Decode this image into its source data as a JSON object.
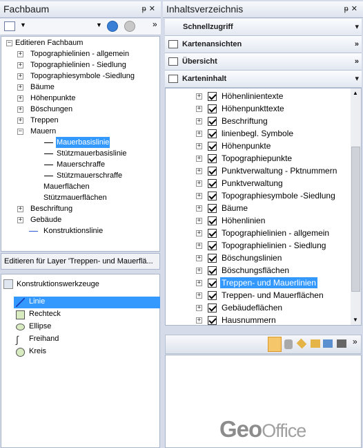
{
  "left_panel": {
    "title": "Fachbaum",
    "tree_root": "Editieren Fachbaum",
    "tree": [
      {
        "label": "Topographielinien - allgemein",
        "level": 1,
        "expander": "+"
      },
      {
        "label": "Topographielinien - Siedlung",
        "level": 1,
        "expander": "+"
      },
      {
        "label": "Topographiesymbole -Siedlung",
        "level": 1,
        "expander": "+"
      },
      {
        "label": "Bäume",
        "level": 1,
        "expander": "+"
      },
      {
        "label": "Höhenpunkte",
        "level": 1,
        "expander": "+"
      },
      {
        "label": "Böschungen",
        "level": 1,
        "expander": "+"
      },
      {
        "label": "Treppen",
        "level": 1,
        "expander": "+"
      },
      {
        "label": "Mauern",
        "level": 1,
        "expander": "-"
      },
      {
        "label": "Mauerbasislinie",
        "level": 2,
        "line": true,
        "selected": true
      },
      {
        "label": "Stützmauerbasislinie",
        "level": 2,
        "line": true
      },
      {
        "label": "Mauerschraffe",
        "level": 2,
        "line": true
      },
      {
        "label": "Stützmauerschraffe",
        "level": 2,
        "line": true
      },
      {
        "label": "Mauerflächen",
        "level": 2
      },
      {
        "label": "Stützmauerflächen",
        "level": 2
      },
      {
        "label": "Beschriftung",
        "level": 1,
        "expander": "+"
      },
      {
        "label": "Gebäude",
        "level": 1,
        "expander": "+"
      },
      {
        "label": "Konstruktionslinie",
        "level": 2,
        "blueline": true
      }
    ],
    "status": "Editieren für Layer 'Treppen- und Mauerflä...",
    "tools_header": "Konstruktionswerkzeuge",
    "tools": [
      {
        "label": "Linie",
        "icon": "line-icon",
        "selected": true
      },
      {
        "label": "Rechteck",
        "icon": "rectangle-icon"
      },
      {
        "label": "Ellipse",
        "icon": "ellipse-icon"
      },
      {
        "label": "Freihand",
        "icon": "freehand-icon"
      },
      {
        "label": "Kreis",
        "icon": "circle-icon"
      }
    ]
  },
  "right_panel": {
    "title": "Inhaltsverzeichnis",
    "sections": [
      {
        "label": "Schnellzugriff",
        "arrow": "▾"
      },
      {
        "label": "Kartenansichten",
        "arrow": "»"
      },
      {
        "label": "Übersicht",
        "arrow": "»"
      },
      {
        "label": "Karteninhalt",
        "arrow": "▾"
      }
    ],
    "layers": [
      {
        "label": "Höhenlinientexte"
      },
      {
        "label": "Höhenpunkttexte"
      },
      {
        "label": "Beschriftung"
      },
      {
        "label": "linienbegl. Symbole"
      },
      {
        "label": "Höhenpunkte"
      },
      {
        "label": "Topographiepunkte"
      },
      {
        "label": "Punktverwaltung - Pktnummern"
      },
      {
        "label": "Punktverwaltung"
      },
      {
        "label": "Topographiesymbole -Siedlung"
      },
      {
        "label": "Bäume"
      },
      {
        "label": "Höhenlinien"
      },
      {
        "label": "Topographielinien - allgemein"
      },
      {
        "label": "Topographielinien - Siedlung"
      },
      {
        "label": "Böschungslinien"
      },
      {
        "label": "Böschungsflächen"
      },
      {
        "label": "Treppen- und Mauerlinien",
        "selected": true
      },
      {
        "label": "Treppen- und Mauerflächen"
      },
      {
        "label": "Gebäudeflächen"
      },
      {
        "label": "Hausnummern"
      }
    ],
    "logo": {
      "geo": "Geo",
      "office": "Office"
    }
  },
  "colors": {
    "selection": "#3399ff",
    "panel_bg": "#d6dbe9"
  }
}
